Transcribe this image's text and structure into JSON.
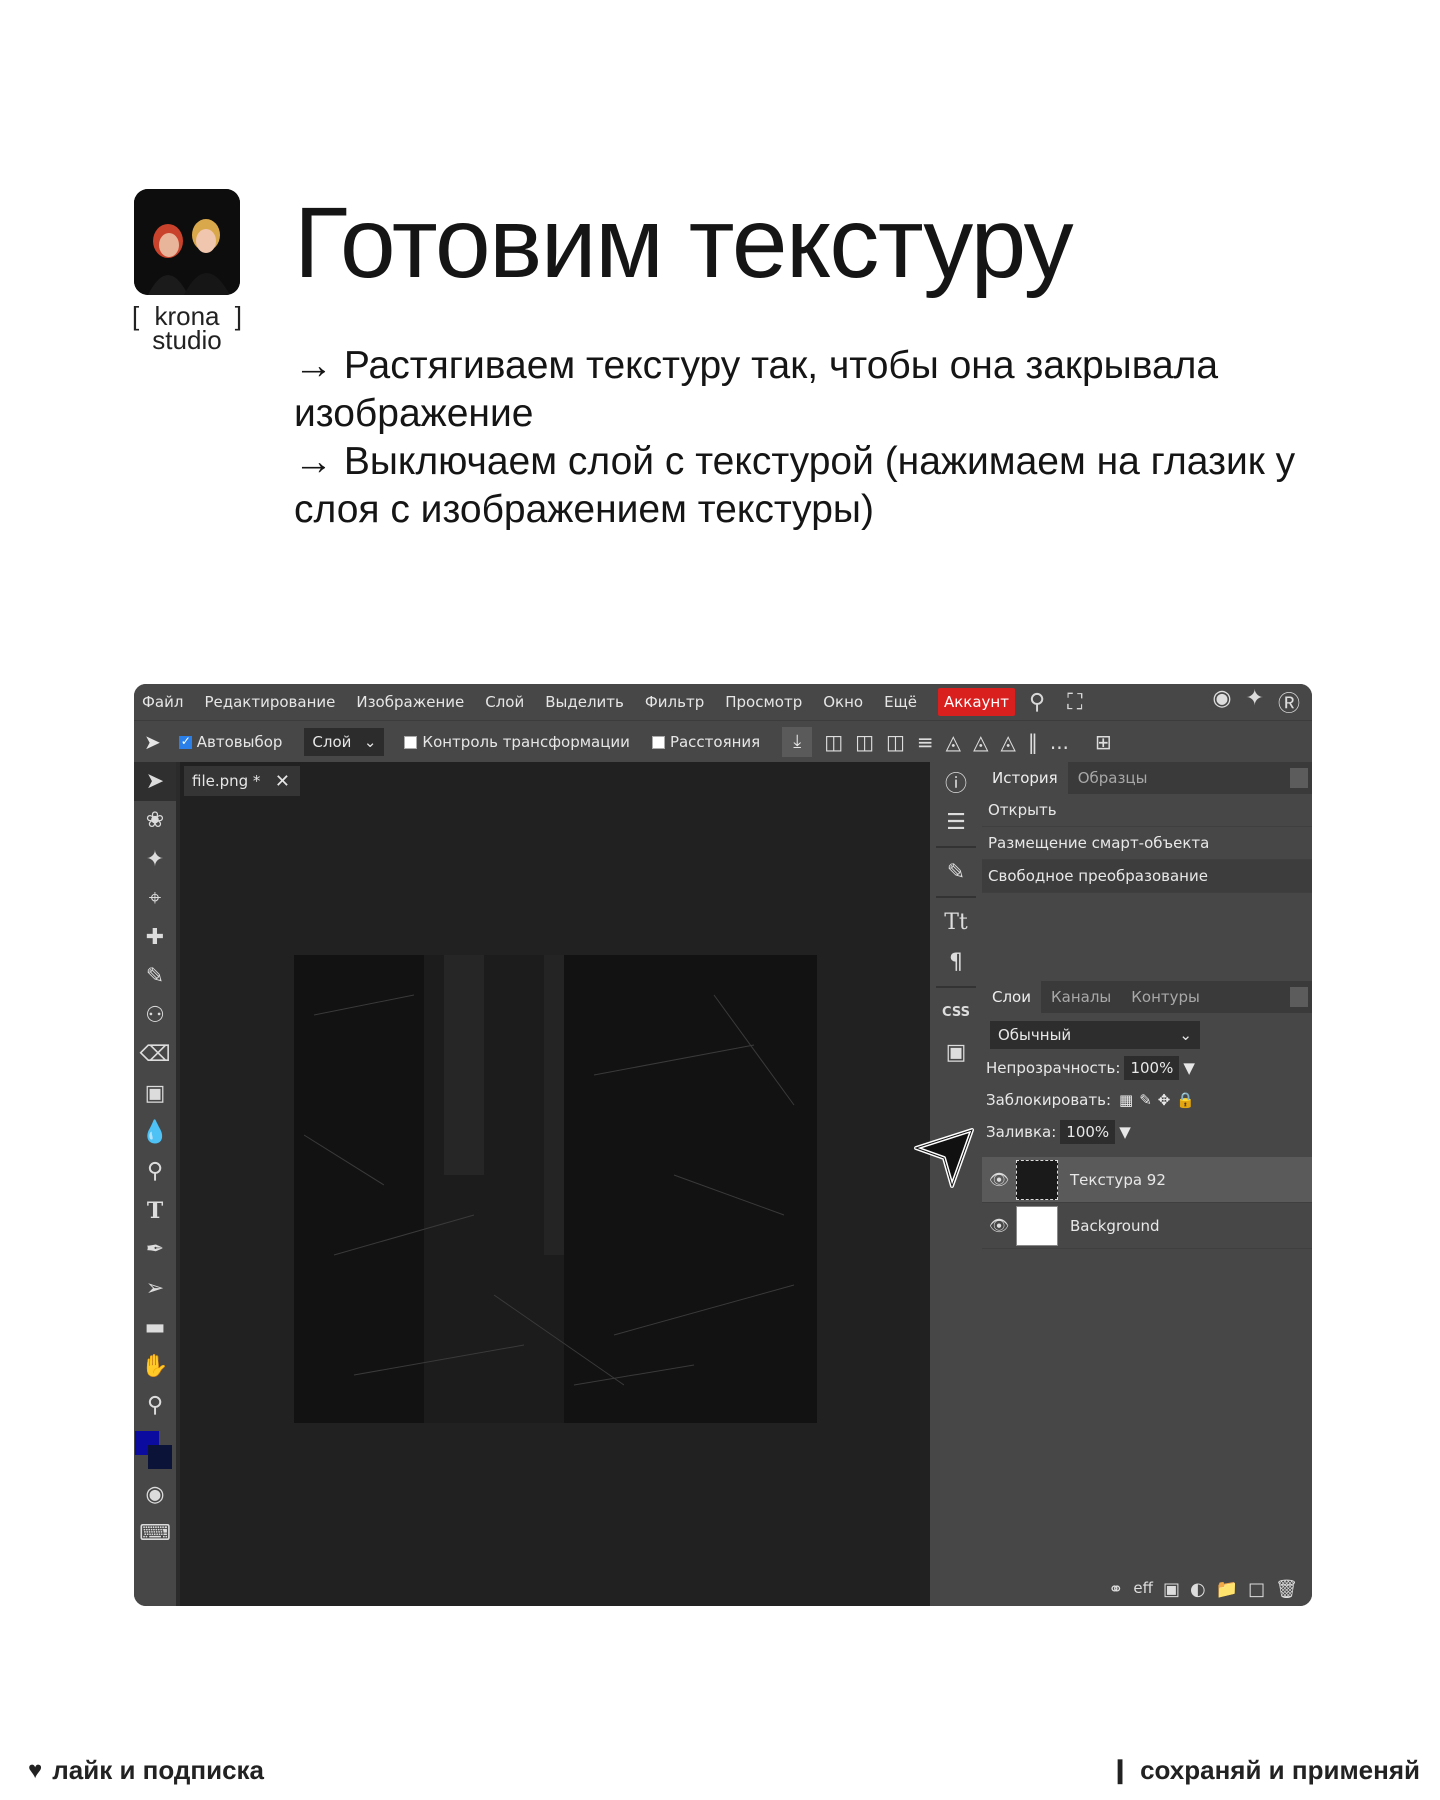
{
  "slide": {
    "brand_line1_open": "[",
    "brand_line1_word": "krona",
    "brand_line1_close": "]",
    "brand_line2": "studio",
    "title": "Готовим текстуру",
    "bullets": [
      "→ Растягиваем текстуру так, чтобы она закрывала изображение",
      "→ Выключаем слой с текстурой (нажимаем на глазик у слоя с изображением текстуры)"
    ]
  },
  "menu": {
    "items": [
      "Файл",
      "Редактирование",
      "Изображение",
      "Слой",
      "Выделить",
      "Фильтр",
      "Просмотр",
      "Окно",
      "Ещё"
    ],
    "account": "Аккаунт",
    "icons": [
      "search-icon",
      "fullscreen-icon",
      "reddit-icon",
      "twitter-icon",
      "facebook-icon"
    ]
  },
  "options": {
    "autoselect_label": "Автовыбор",
    "autoselect_checked": true,
    "layer_select": "Слой",
    "transform_label": "Контроль трансформации",
    "distances_label": "Расстояния",
    "more": "..."
  },
  "document": {
    "tab_name": "file.png *"
  },
  "history": {
    "tabs": [
      "История",
      "Образцы"
    ],
    "items": [
      "Открыть",
      "Размещение смарт-объекта",
      "Свободное преобразование"
    ]
  },
  "layers": {
    "tabs": [
      "Слои",
      "Каналы",
      "Контуры"
    ],
    "blend_mode": "Обычный",
    "opacity_label": "Непрозрачность:",
    "opacity_value": "100%",
    "lock_label": "Заблокировать:",
    "fill_label": "Заливка:",
    "fill_value": "100%",
    "list": [
      {
        "name": "Текстура 92"
      },
      {
        "name": "Background"
      }
    ],
    "footer_effects": "eff"
  },
  "footer": {
    "left": "лайк и подписка",
    "right": "сохраняй и применяй"
  },
  "colors": {
    "accent_account": "#d9201f",
    "foreground_swatch": "#0b0ba0",
    "background_swatch": "#0b1438"
  }
}
